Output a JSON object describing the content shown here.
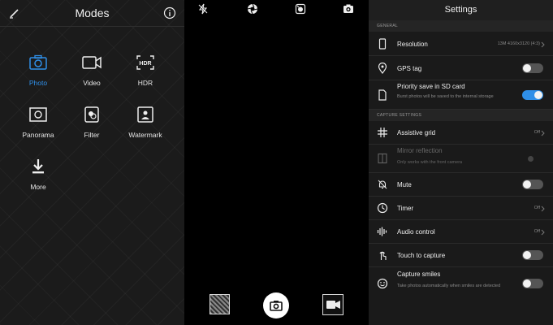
{
  "modes_panel": {
    "title": "Modes",
    "items": [
      {
        "label": "Photo",
        "icon": "camera-icon",
        "active": true
      },
      {
        "label": "Video",
        "icon": "video-camera-icon"
      },
      {
        "label": "HDR",
        "icon": "hdr-icon"
      },
      {
        "label": "Panorama",
        "icon": "panorama-icon"
      },
      {
        "label": "Filter",
        "icon": "filter-icon"
      },
      {
        "label": "Watermark",
        "icon": "watermark-icon"
      },
      {
        "label": "More",
        "icon": "download-icon"
      }
    ],
    "hdr_glyph": "HDR"
  },
  "camera": {
    "top_icons": [
      "flash-off-icon",
      "aperture-icon",
      "filter-effect-icon",
      "switch-camera-icon"
    ],
    "bottom": {
      "gallery": "gallery-thumbnail",
      "shutter": "shutter-button",
      "video": "video-record-button"
    }
  },
  "settings": {
    "title": "Settings",
    "accent": "#2f8fe8",
    "sections": [
      {
        "label": "GENERAL",
        "rows": [
          {
            "name": "Resolution",
            "value": "13M 4160x3120 (4:3)",
            "icon": "phone-icon"
          },
          {
            "name": "GPS tag",
            "toggle": false,
            "icon": "location-pin-icon"
          },
          {
            "name": "Priority save in SD card",
            "sub": "Burst photos will be saved to the internal storage",
            "toggle": true,
            "icon": "file-icon"
          }
        ]
      },
      {
        "label": "CAPTURE SETTINGS",
        "rows": [
          {
            "name": "Assistive grid",
            "value": "Off",
            "icon": "grid-icon"
          },
          {
            "name": "Mirror reflection",
            "sub": "Only works with the front camera",
            "disabled": true,
            "icon": "mirror-icon"
          },
          {
            "name": "Mute",
            "toggle": false,
            "icon": "mute-bell-icon"
          },
          {
            "name": "Timer",
            "value": "Off",
            "icon": "timer-icon"
          },
          {
            "name": "Audio control",
            "value": "Off",
            "icon": "audio-wave-icon"
          },
          {
            "name": "Touch to capture",
            "toggle": false,
            "icon": "touch-icon"
          },
          {
            "name": "Capture smiles",
            "sub": "Take photos automatically when smiles are detected",
            "toggle": false,
            "icon": "smile-icon"
          }
        ]
      }
    ]
  }
}
